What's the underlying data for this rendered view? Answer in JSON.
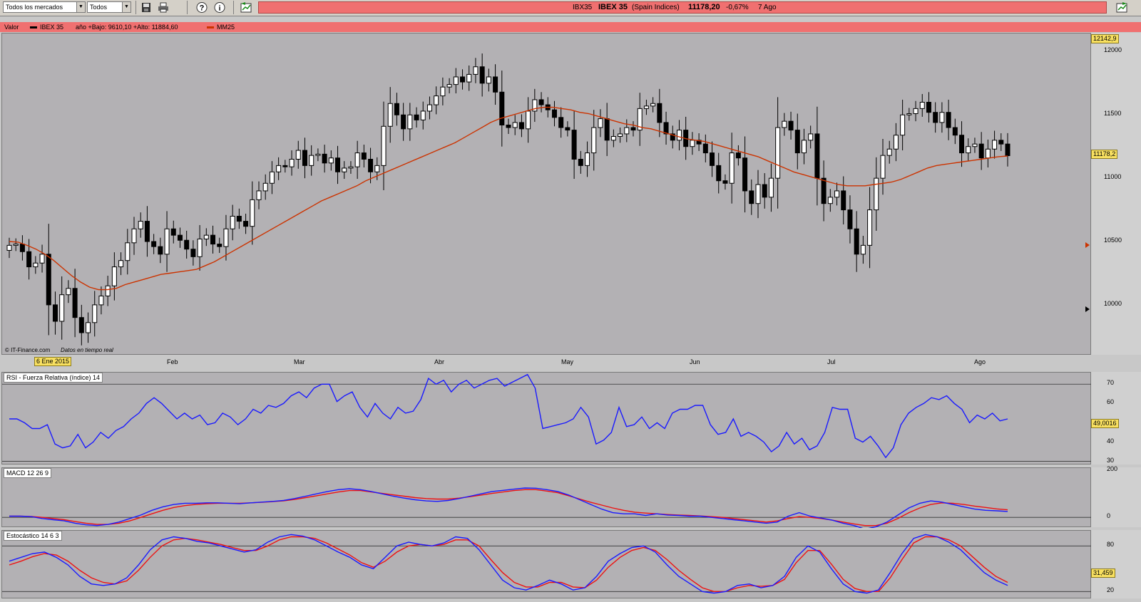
{
  "toolbar": {
    "market_select": "Todos los mercados",
    "type_select": "Todos",
    "save_icon": "floppy-disk-icon",
    "print_icon": "printer-icon",
    "help_icon": "question-icon",
    "info_icon": "info-icon"
  },
  "ticker": {
    "code": "IBX35",
    "name": "IBEX 35",
    "market": "(Spain Indices)",
    "price": "11178,20",
    "change": "-0,67%",
    "date": "7 Ago"
  },
  "main_panel": {
    "header_valor": "Valor",
    "header_series": "IBEX 35",
    "header_range": "año +Bajo: 9610,10 +Alto: 11884,60",
    "header_ma": "MM25",
    "credit": "© IT-Finance.com",
    "realtime": "Datos en tiempo real",
    "cursor_date": "6 Ene 2015",
    "top_value_label": "12142,9",
    "last_value_label": "11178,2",
    "y_ticks": [
      "12000",
      "11500",
      "11000",
      "10500",
      "10000"
    ],
    "x_ticks": [
      "Feb",
      "Mar",
      "Abr",
      "May",
      "Jun",
      "Jul",
      "Ago"
    ]
  },
  "rsi_panel": {
    "title": "RSI - Fuerza Relativa (índice) 14",
    "value_label": "49,0016",
    "y_ticks": [
      "70",
      "60",
      "40",
      "30"
    ]
  },
  "macd_panel": {
    "title": "MACD 12 26 9",
    "y_ticks": [
      "200",
      "0"
    ]
  },
  "stoch_panel": {
    "title": "Estocástico 14 6 3",
    "value_label": "31,459",
    "y_ticks": [
      "80",
      "20"
    ]
  },
  "colors": {
    "bull": "#ffffff",
    "bear": "#000000",
    "ma": "#cc3300",
    "line_blue": "#1a1aff",
    "line_red": "#ee1111",
    "plot_bg": "#b3b1b4",
    "header": "#f07070"
  },
  "chart_data": {
    "type": "candlestick",
    "title": "IBEX 35",
    "x_ticks": [
      "Feb",
      "Mar",
      "Abr",
      "May",
      "Jun",
      "Jul",
      "Ago"
    ],
    "ylim": [
      9600,
      12142.9
    ],
    "y_ticks": [
      12000,
      11500,
      11000,
      10500,
      10000
    ],
    "low": 9610.1,
    "high": 11884.6,
    "last": 11178.2,
    "change_pct": -0.67,
    "close": [
      10470,
      10480,
      10420,
      10300,
      10330,
      10400,
      10000,
      9870,
      10080,
      10130,
      9900,
      9780,
      9860,
      10000,
      10070,
      10150,
      10300,
      10350,
      10490,
      10600,
      10660,
      10500,
      10460,
      10400,
      10600,
      10550,
      10510,
      10440,
      10380,
      10520,
      10550,
      10480,
      10460,
      10600,
      10700,
      10660,
      10620,
      10830,
      10900,
      10960,
      11050,
      11100,
      11090,
      11150,
      11220,
      11100,
      11180,
      11190,
      11120,
      11160,
      11050,
      11080,
      11090,
      11200,
      11150,
      11050,
      11100,
      11410,
      11590,
      11500,
      11390,
      11500,
      11460,
      11530,
      11580,
      11650,
      11720,
      11740,
      11800,
      11760,
      11820,
      11880,
      11750,
      11800,
      11680,
      11420,
      11400,
      11440,
      11390,
      11530,
      11620,
      11580,
      11540,
      11480,
      11400,
      11380,
      11150,
      11100,
      11200,
      11400,
      11470,
      11300,
      11330,
      11350,
      11400,
      11380,
      11550,
      11570,
      11590,
      11440,
      11350,
      11300,
      11380,
      11250,
      11300,
      11270,
      11200,
      11100,
      10980,
      10960,
      11200,
      11160,
      10900,
      10800,
      10950,
      10850,
      11000,
      11400,
      11450,
      11380,
      11200,
      11300,
      11350,
      11000,
      10800,
      10850,
      10900,
      10750,
      10600,
      10400,
      10470,
      10750,
      11000,
      11180,
      11230,
      11340,
      11500,
      11510,
      11550,
      11600,
      11520,
      11440,
      11520,
      11400,
      11340,
      11200,
      11250,
      11270,
      11160,
      11230,
      11300,
      11270,
      11178
    ],
    "ma25": [
      10500,
      10495,
      10470,
      10440,
      10400,
      10350,
      10290,
      10230,
      10180,
      10140,
      10120,
      10120,
      10130,
      10160,
      10180,
      10200,
      10220,
      10240,
      10250,
      10260,
      10270,
      10280,
      10310,
      10340,
      10380,
      10420,
      10460,
      10500,
      10540,
      10580,
      10620,
      10660,
      10700,
      10740,
      10780,
      10820,
      10850,
      10880,
      10910,
      10940,
      10980,
      11010,
      11040,
      11070,
      11100,
      11130,
      11160,
      11190,
      11220,
      11250,
      11280,
      11320,
      11360,
      11400,
      11440,
      11470,
      11490,
      11510,
      11530,
      11550,
      11560,
      11560,
      11550,
      11540,
      11520,
      11510,
      11490,
      11470,
      11450,
      11430,
      11420,
      11400,
      11390,
      11370,
      11350,
      11330,
      11310,
      11300,
      11290,
      11270,
      11250,
      11230,
      11210,
      11190,
      11170,
      11140,
      11110,
      11080,
      11050,
      11030,
      11010,
      10990,
      10970,
      10950,
      10940,
      10940,
      10940,
      10950,
      10960,
      10970,
      10990,
      11020,
      11050,
      11080,
      11100,
      11110,
      11120,
      11130,
      11140,
      11150,
      11160,
      11170,
      11175
    ],
    "rsi": [
      52,
      52,
      50,
      47,
      47,
      49,
      39,
      37,
      38,
      44,
      37,
      40,
      45,
      42,
      46,
      48,
      52,
      55,
      60,
      63,
      60,
      56,
      52,
      55,
      52,
      54,
      49,
      50,
      55,
      53,
      49,
      52,
      57,
      55,
      59,
      58,
      60,
      64,
      66,
      63,
      68,
      70,
      70,
      61,
      64,
      66,
      58,
      53,
      60,
      55,
      52,
      58,
      55,
      56,
      62,
      73,
      70,
      72,
      66,
      70,
      72,
      68,
      70,
      72,
      73,
      69,
      71,
      73,
      75,
      68,
      47,
      48,
      49,
      50,
      52,
      58,
      53,
      39,
      41,
      45,
      58,
      48,
      49,
      53,
      47,
      50,
      47,
      55,
      57,
      57,
      59,
      59,
      49,
      44,
      45,
      52,
      43,
      45,
      43,
      40,
      35,
      38,
      45,
      39,
      42,
      36,
      38,
      45,
      58,
      57,
      57,
      42,
      40,
      43,
      38,
      32,
      37,
      49,
      55,
      58,
      60,
      63,
      62,
      64,
      60,
      57,
      50,
      54,
      52,
      55,
      51,
      52
    ],
    "macd_line": [
      5,
      5,
      3,
      -5,
      -10,
      -15,
      -25,
      -32,
      -35,
      -30,
      -20,
      -5,
      10,
      30,
      45,
      55,
      60,
      60,
      62,
      62,
      60,
      58,
      62,
      65,
      68,
      72,
      80,
      90,
      100,
      110,
      118,
      122,
      118,
      110,
      100,
      90,
      82,
      75,
      70,
      68,
      72,
      80,
      90,
      100,
      110,
      115,
      120,
      125,
      124,
      118,
      110,
      95,
      75,
      55,
      35,
      20,
      15,
      15,
      8,
      15,
      10,
      8,
      5,
      5,
      0,
      -5,
      -10,
      -15,
      -20,
      -25,
      -20,
      5,
      20,
      5,
      -3,
      -12,
      -25,
      -35,
      -50,
      -40,
      -20,
      10,
      40,
      60,
      70,
      65,
      55,
      45,
      35,
      30,
      28,
      25
    ],
    "macd_signal": [
      5,
      5,
      4,
      0,
      -5,
      -10,
      -18,
      -25,
      -30,
      -30,
      -25,
      -15,
      0,
      15,
      30,
      42,
      50,
      55,
      58,
      60,
      60,
      60,
      62,
      64,
      67,
      70,
      76,
      84,
      92,
      100,
      108,
      114,
      114,
      108,
      102,
      96,
      90,
      84,
      80,
      78,
      78,
      82,
      88,
      95,
      102,
      108,
      114,
      118,
      118,
      112,
      105,
      92,
      78,
      64,
      52,
      40,
      30,
      22,
      18,
      15,
      12,
      10,
      8,
      6,
      3,
      0,
      -5,
      -10,
      -15,
      -20,
      -15,
      -5,
      3,
      0,
      -5,
      -12,
      -20,
      -28,
      -35,
      -35,
      -25,
      -5,
      20,
      40,
      55,
      62,
      60,
      55,
      48,
      42,
      36,
      32
    ],
    "stoch_k": [
      60,
      65,
      70,
      72,
      65,
      55,
      40,
      30,
      28,
      30,
      38,
      55,
      75,
      88,
      92,
      90,
      86,
      84,
      80,
      76,
      72,
      75,
      85,
      92,
      95,
      93,
      88,
      80,
      72,
      65,
      55,
      50,
      65,
      80,
      85,
      82,
      80,
      84,
      92,
      90,
      75,
      55,
      35,
      25,
      22,
      28,
      35,
      30,
      22,
      25,
      40,
      60,
      70,
      78,
      80,
      72,
      55,
      40,
      30,
      20,
      18,
      20,
      28,
      30,
      25,
      28,
      40,
      65,
      80,
      72,
      50,
      30,
      20,
      18,
      22,
      45,
      70,
      90,
      95,
      92,
      85,
      75,
      60,
      45,
      35,
      28
    ],
    "stoch_d": [
      55,
      60,
      66,
      70,
      68,
      60,
      48,
      38,
      32,
      30,
      34,
      48,
      65,
      80,
      88,
      90,
      88,
      85,
      82,
      78,
      74,
      74,
      80,
      88,
      92,
      92,
      90,
      84,
      76,
      68,
      58,
      52,
      60,
      72,
      80,
      82,
      80,
      82,
      88,
      88,
      80,
      62,
      45,
      32,
      26,
      26,
      32,
      32,
      26,
      25,
      35,
      52,
      65,
      74,
      78,
      74,
      62,
      48,
      36,
      25,
      20,
      20,
      25,
      28,
      27,
      28,
      36,
      58,
      74,
      74,
      56,
      36,
      24,
      20,
      20,
      38,
      62,
      84,
      92,
      92,
      88,
      80,
      66,
      52,
      40,
      32
    ]
  }
}
